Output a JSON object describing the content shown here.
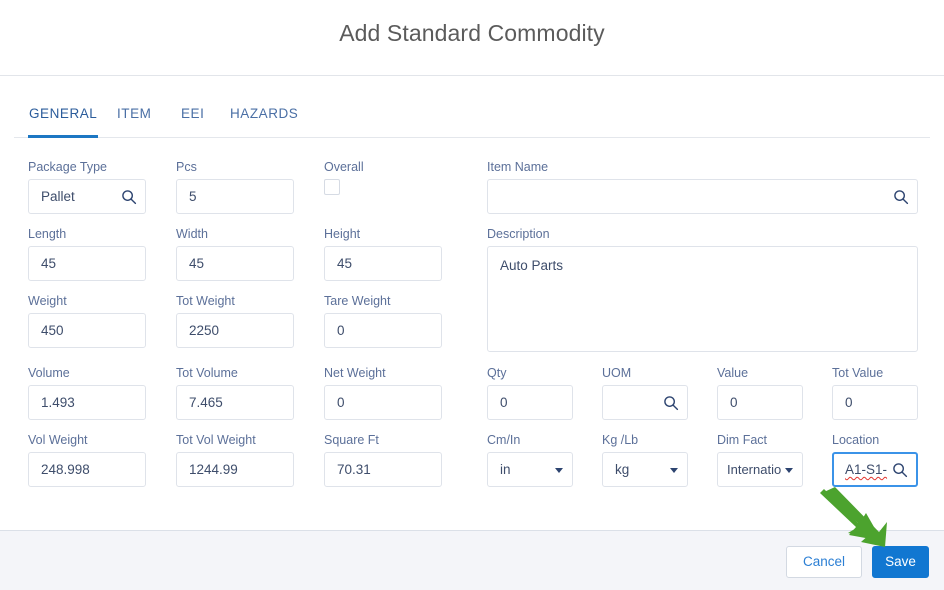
{
  "header": {
    "title": "Add Standard Commodity"
  },
  "tabs": [
    {
      "label": "GENERAL",
      "active": true
    },
    {
      "label": "ITEM",
      "active": false
    },
    {
      "label": "EEI",
      "active": false
    },
    {
      "label": "HAZARDS",
      "active": false
    }
  ],
  "form": {
    "package_type": {
      "label": "Package Type",
      "value": "Pallet",
      "icon": "search-icon"
    },
    "pcs": {
      "label": "Pcs",
      "value": "5"
    },
    "overall": {
      "label": "Overall",
      "checked": false
    },
    "item_name": {
      "label": "Item Name",
      "value": "",
      "icon": "search-icon"
    },
    "length": {
      "label": "Length",
      "value": "45"
    },
    "width": {
      "label": "Width",
      "value": "45"
    },
    "height": {
      "label": "Height",
      "value": "45"
    },
    "description": {
      "label": "Description",
      "value": "Auto Parts"
    },
    "weight": {
      "label": "Weight",
      "value": "450"
    },
    "tot_weight": {
      "label": "Tot Weight",
      "value": "2250"
    },
    "tare_weight": {
      "label": "Tare Weight",
      "value": "0"
    },
    "volume": {
      "label": "Volume",
      "value": "1.493"
    },
    "tot_volume": {
      "label": "Tot Volume",
      "value": "7.465"
    },
    "net_weight": {
      "label": "Net Weight",
      "value": "0"
    },
    "qty": {
      "label": "Qty",
      "value": "0"
    },
    "uom": {
      "label": "UOM",
      "value": "",
      "icon": "search-icon"
    },
    "value": {
      "label": "Value",
      "value": "0"
    },
    "tot_value": {
      "label": "Tot Value",
      "value": "0"
    },
    "vol_weight": {
      "label": "Vol Weight",
      "value": "248.998"
    },
    "tot_vol_weight": {
      "label": "Tot Vol Weight",
      "value": "1244.99"
    },
    "square_ft": {
      "label": "Square Ft",
      "value": "70.31"
    },
    "cm_in": {
      "label": "Cm/In",
      "value": "in"
    },
    "kg_lb": {
      "label": "Kg /Lb",
      "value": "kg"
    },
    "dim_fact": {
      "label": "Dim Fact",
      "value": "Internatio"
    },
    "location": {
      "label": "Location",
      "value": "A1-S1-",
      "focused": true,
      "icon": "search-icon"
    }
  },
  "footer": {
    "cancel_label": "Cancel",
    "save_label": "Save"
  },
  "annotation": {
    "arrow_color": "#4ca32e",
    "points_to": "save-button"
  },
  "colors": {
    "accent": "#1177d1",
    "tab_active": "#2b5c9b",
    "label": "#5c7099",
    "value": "#3e4d6b",
    "footer_bg": "#f4f5f9",
    "focus_border": "#3b93e8",
    "spellcheck": "#e2342d"
  }
}
